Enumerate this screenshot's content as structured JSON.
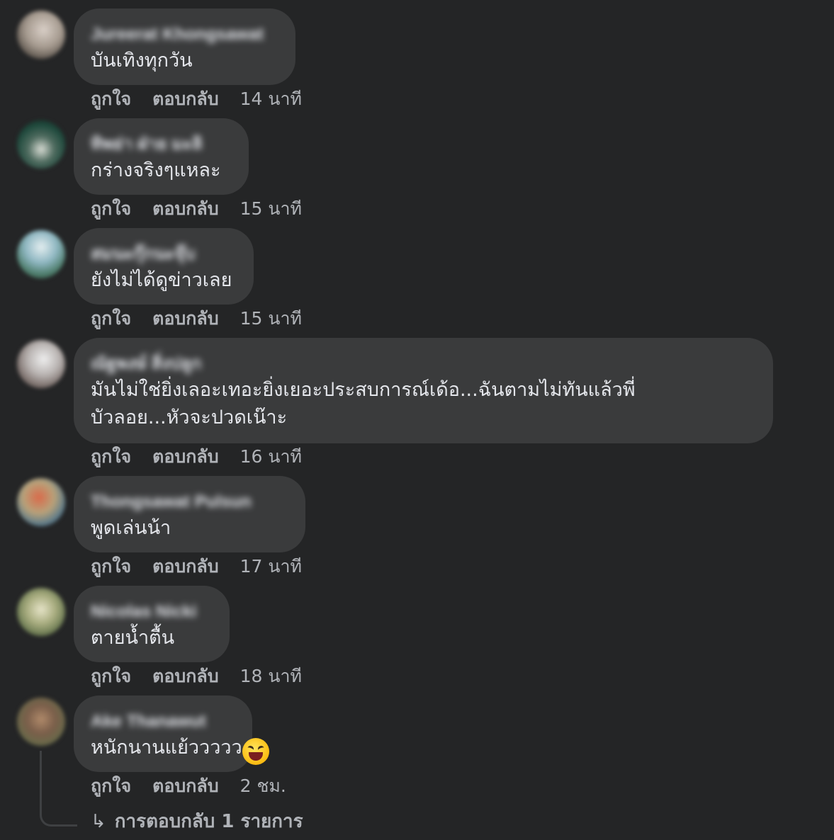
{
  "labels": {
    "like": "ถูกใจ",
    "reply": "ตอบกลับ"
  },
  "comments": [
    {
      "author": "Jureerat Khongsawat",
      "text": "บันเทิงทุกวัน",
      "time": "14 นาที"
    },
    {
      "author": "ทิพย่า ฝ่าย มะลิ",
      "text": "กร่างจริงๆแหละ",
      "time": "15 นาที"
    },
    {
      "author": "สมนะกุ๊กนะจุ๊บ",
      "text": "ยังไม่ได้ดูข่าวเลย",
      "time": "15 นาที"
    },
    {
      "author": "ณัฐพงษ์ สิ่งปลูก",
      "text": "มันไม่ใช่ยิ่งเลอะเทอะยิ่งเยอะประสบการณ์เด้อ...ฉันตามไม่ทันแล้วพี่บัวลอย...หัวจะปวดเน๊าะ",
      "time": "16 นาที"
    },
    {
      "author": "Thongsawat Pulsun",
      "text": "พูดเล่นน้า",
      "time": "17 นาที"
    },
    {
      "author": "Nicolas Nicki",
      "text": "ตายน้ำตื้น",
      "time": "18 นาที"
    },
    {
      "author": "Ake Thanawut",
      "text": "หนักนานแย้ววววว",
      "time": "2 ชม.",
      "emoji": "laughing-squint-emoji"
    }
  ],
  "replies_link": {
    "icon": "reply-arrow-icon",
    "text": "การตอบกลับ 1 รายการ"
  },
  "colors": {
    "background": "#242526",
    "bubble": "#3a3b3c",
    "text": "#e4e6eb",
    "secondary_text": "#b0b3b8"
  }
}
